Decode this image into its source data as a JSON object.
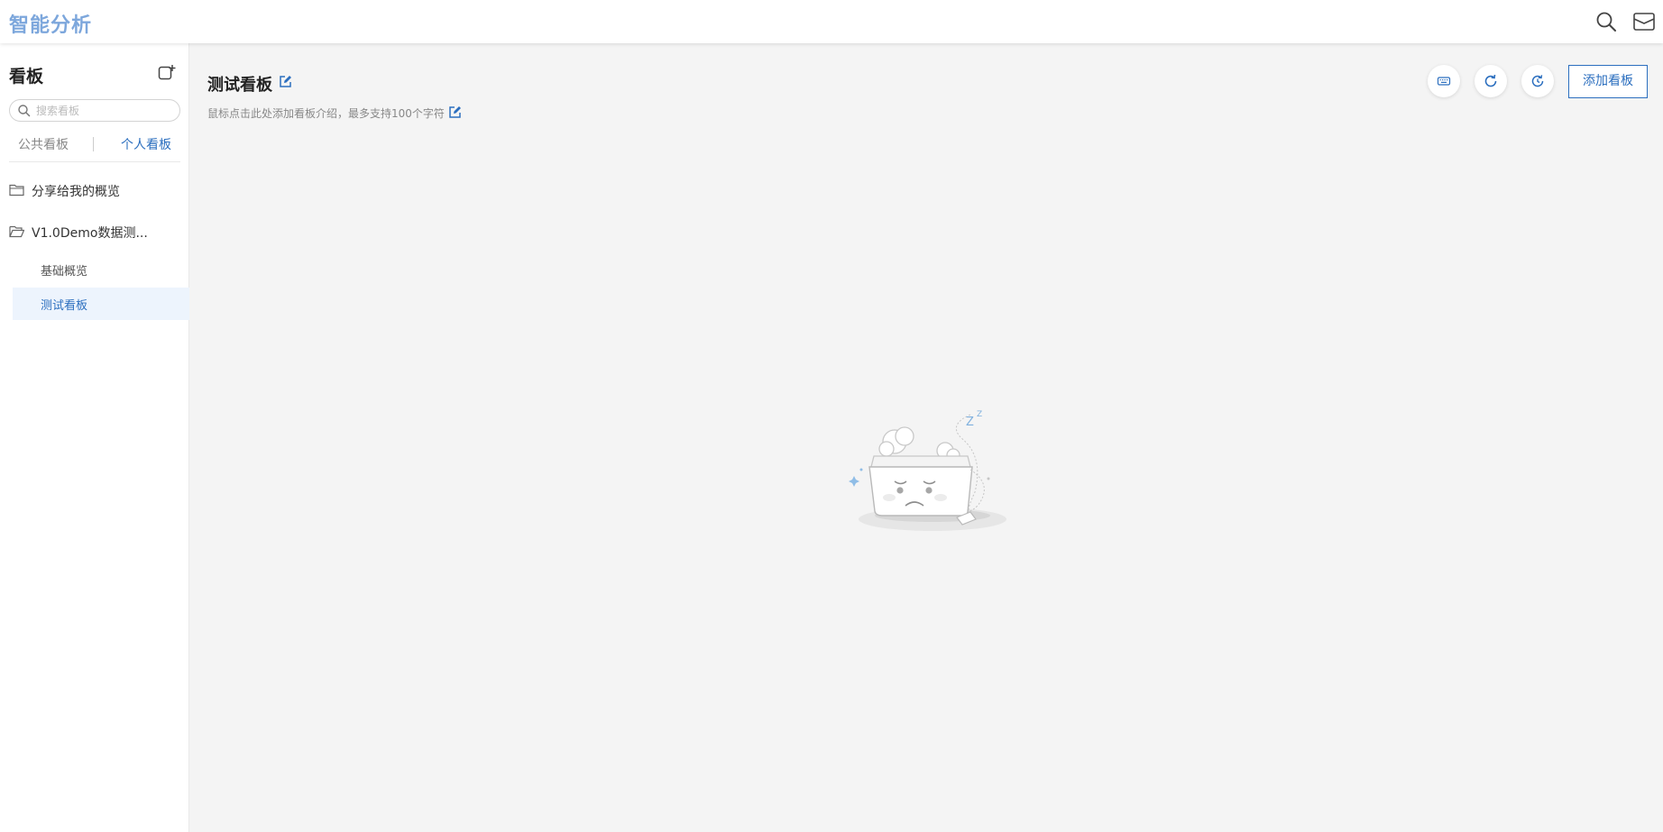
{
  "app": {
    "title": "智能分析"
  },
  "topbar": {
    "icons": [
      "search-icon",
      "mail-icon"
    ]
  },
  "sidebar": {
    "title": "看板",
    "search": {
      "placeholder": "搜索看板",
      "value": ""
    },
    "tabs": [
      {
        "label": "公共看板",
        "active": false
      },
      {
        "label": "个人看板",
        "active": true
      }
    ],
    "tree": [
      {
        "label": "分享给我的概览",
        "icon": "folder-icon",
        "expanded": false,
        "children": []
      },
      {
        "label": "V1.0Demo数据测...",
        "icon": "folder-open-icon",
        "expanded": true,
        "children": [
          {
            "label": "基础概览",
            "selected": false
          },
          {
            "label": "测试看板",
            "selected": true
          }
        ]
      }
    ]
  },
  "main": {
    "board_title": "测试看板",
    "board_description": "鼠标点击此处添加看板介绍，最多支持100个字符",
    "toolbar": {
      "icons": [
        "keyboard-icon",
        "refresh-icon",
        "auto-refresh-icon"
      ],
      "add_board_label": "添加看板"
    },
    "empty_state": {
      "illustration": "sleeping-box-empty-illustration"
    }
  },
  "colors": {
    "accent": "#2c6fbf",
    "app_title": "#7da7dc",
    "selected_bg": "#edf4fd",
    "page_bg": "#f4f4f4"
  }
}
